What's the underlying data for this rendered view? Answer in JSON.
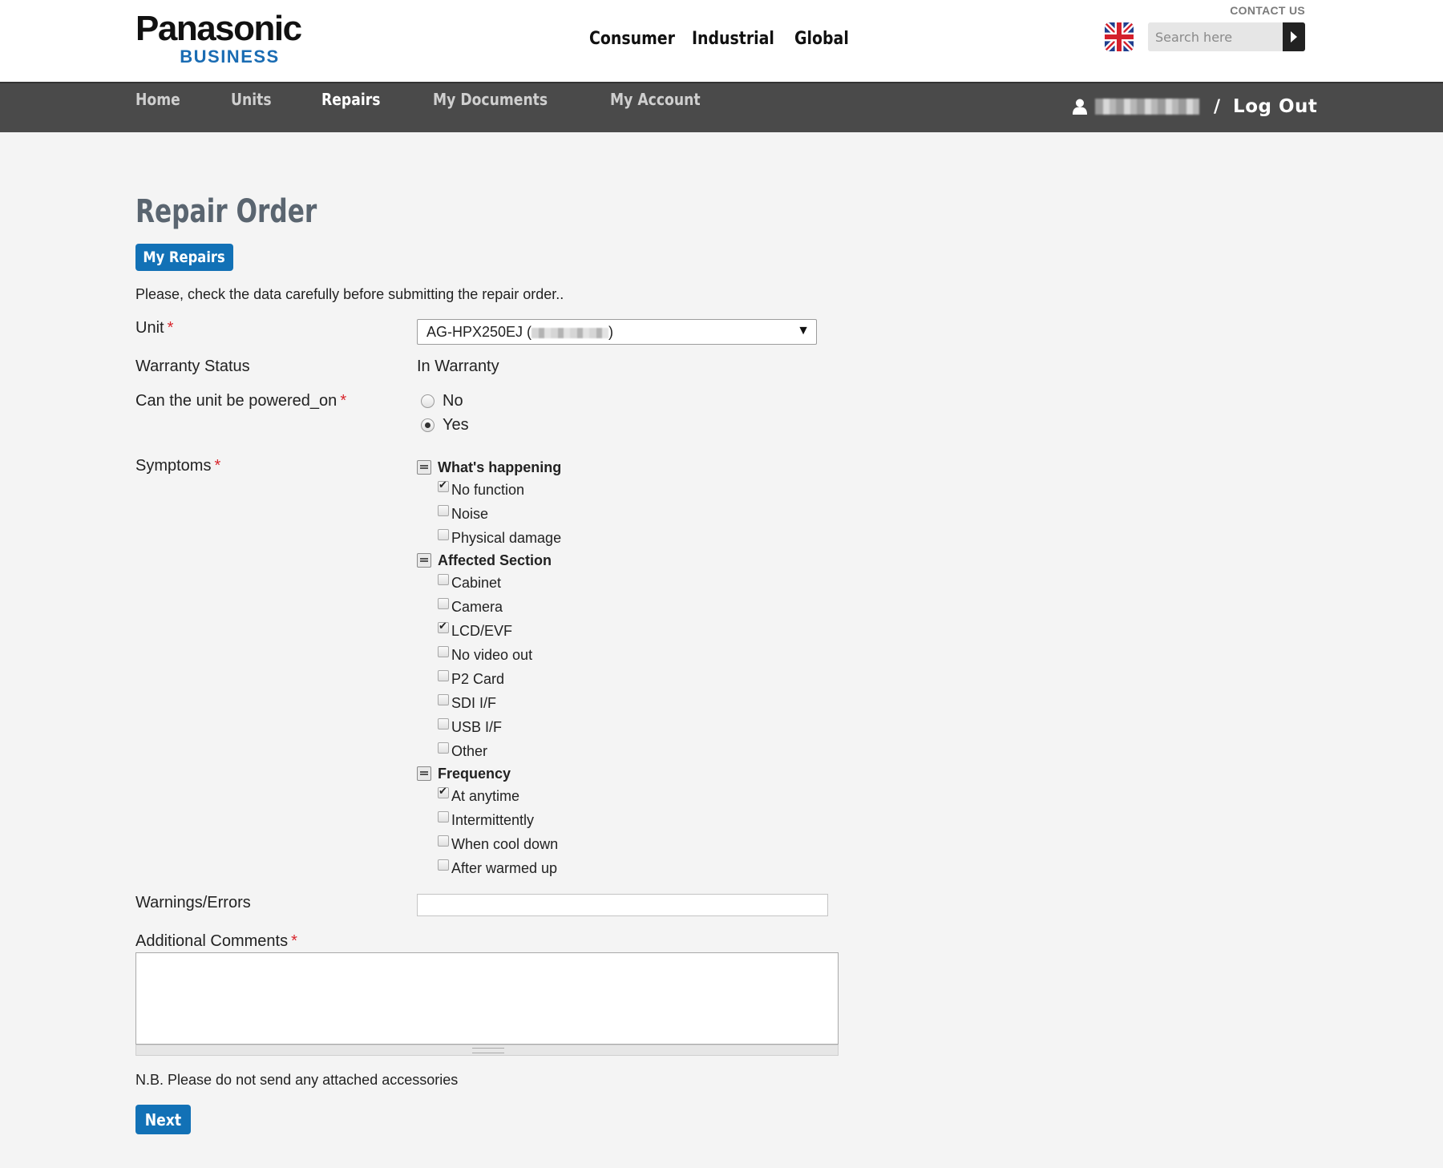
{
  "brand": {
    "name": "Panasonic",
    "sub": "BUSINESS"
  },
  "header": {
    "contact_us": "CONTACT US",
    "top_nav": [
      "Consumer",
      "Industrial",
      "Global"
    ],
    "search": {
      "placeholder": "Search here"
    },
    "flag_icon": "uk-flag-icon"
  },
  "nav": {
    "items": [
      "Home",
      "Units",
      "Repairs",
      "My Documents",
      "My Account"
    ],
    "active": "Repairs",
    "user_icon": "user-icon",
    "slash": "/",
    "logout": "Log Out"
  },
  "page": {
    "title": "Repair Order",
    "my_repairs_button": "My Repairs",
    "intro": "Please, check the data carefully before submitting the repair order..",
    "required_mark": "*"
  },
  "form": {
    "unit": {
      "label": "Unit",
      "value_prefix": "AG-HPX250EJ (",
      "value_suffix": ")"
    },
    "warranty": {
      "label": "Warranty Status",
      "value": "In Warranty"
    },
    "powered_on": {
      "label": "Can the unit be powered_on",
      "options": [
        {
          "label": "No",
          "selected": false
        },
        {
          "label": "Yes",
          "selected": true
        }
      ]
    },
    "symptoms": {
      "label": "Symptoms",
      "groups": [
        {
          "title": "What's happening",
          "items": [
            {
              "label": "No function",
              "checked": true
            },
            {
              "label": "Noise",
              "checked": false
            },
            {
              "label": "Physical damage",
              "checked": false
            }
          ]
        },
        {
          "title": "Affected Section",
          "items": [
            {
              "label": "Cabinet",
              "checked": false
            },
            {
              "label": "Camera",
              "checked": false
            },
            {
              "label": "LCD/EVF",
              "checked": true
            },
            {
              "label": "No video out",
              "checked": false
            },
            {
              "label": "P2 Card",
              "checked": false
            },
            {
              "label": "SDI I/F",
              "checked": false
            },
            {
              "label": "USB I/F",
              "checked": false
            },
            {
              "label": "Other",
              "checked": false
            }
          ]
        },
        {
          "title": "Frequency",
          "items": [
            {
              "label": "At anytime",
              "checked": true
            },
            {
              "label": "Intermittently",
              "checked": false
            },
            {
              "label": "When cool down",
              "checked": false
            },
            {
              "label": "After warmed up",
              "checked": false
            }
          ]
        }
      ]
    },
    "warnings": {
      "label": "Warnings/Errors",
      "value": ""
    },
    "comments": {
      "label": "Additional Comments",
      "value": ""
    },
    "note": "N.B. Please do not send any attached accessories",
    "next_button": "Next"
  },
  "colors": {
    "accent": "#1271b6",
    "nav_bg": "#4a4a4a",
    "required": "#d8262d",
    "title": "#5a6570"
  }
}
